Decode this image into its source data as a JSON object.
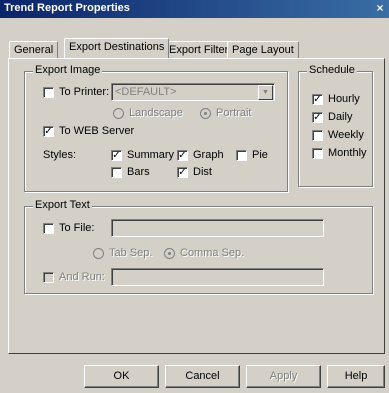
{
  "window": {
    "title": "Trend Report Properties",
    "close": "×"
  },
  "tabs": [
    "General",
    "Export Destinations",
    "Export Filter",
    "Page Layout"
  ],
  "export_image": {
    "legend": "Export Image",
    "to_printer_label": "To Printer:",
    "printer_value": "<DEFAULT>",
    "landscape_label": "Landscape",
    "portrait_label": "Portrait",
    "to_web_label": "To WEB Server",
    "styles_label": "Styles:",
    "summary_label": "Summary",
    "graph_label": "Graph",
    "pie_label": "Pie",
    "bars_label": "Bars",
    "dist_label": "Dist",
    "checks": {
      "to_printer": "",
      "to_web": "✓",
      "summary": "✓",
      "graph": "✓",
      "pie": "",
      "bars": "",
      "dist": "✓"
    }
  },
  "schedule": {
    "legend": "Schedule",
    "hourly_label": "Hourly",
    "daily_label": "Daily",
    "weekly_label": "Weekly",
    "monthly_label": "Monthly",
    "checks": {
      "hourly": "✓",
      "daily": "✓",
      "weekly": "",
      "monthly": ""
    }
  },
  "export_text": {
    "legend": "Export Text",
    "to_file_label": "To File:",
    "tab_sep_label": "Tab Sep.",
    "comma_sep_label": "Comma Sep.",
    "and_run_label": "And Run:",
    "checks": {
      "to_file": "",
      "and_run": ""
    }
  },
  "buttons": {
    "ok": "OK",
    "cancel": "Cancel",
    "apply": "Apply",
    "help": "Help"
  }
}
